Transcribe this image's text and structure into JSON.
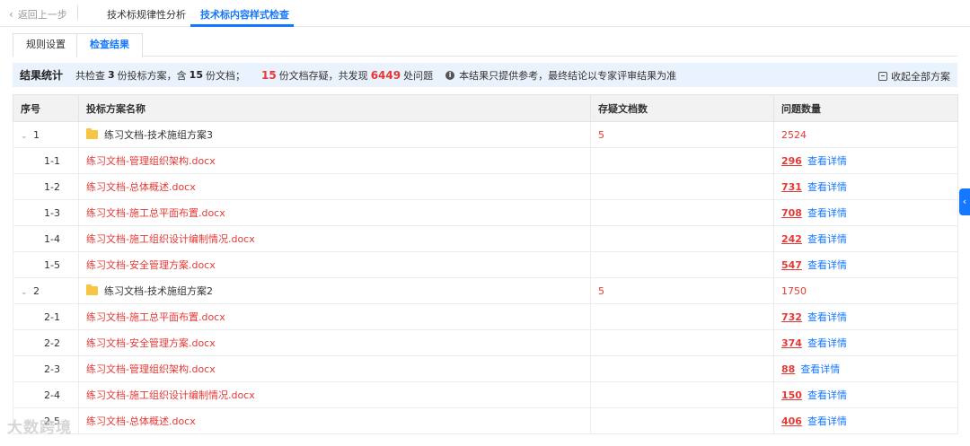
{
  "topnav": {
    "back_label": "返回上一步",
    "tabs": [
      {
        "label": "技术标规律性分析"
      },
      {
        "label": "技术标内容样式检查"
      }
    ]
  },
  "subtabs": [
    {
      "label": "规则设置"
    },
    {
      "label": "检查结果"
    }
  ],
  "stats": {
    "label": "结果统计",
    "t1": "共检查",
    "plans": "3",
    "t2": "份投标方案，含",
    "docs": "15",
    "t3": "份文档；",
    "suspicious": "15",
    "t4": "份文档存疑，共发现",
    "issues": "6449",
    "t5": "处问题",
    "note": "本结果只提供参考，最终结论以专家评审结果为准",
    "collapse_label": "收起全部方案"
  },
  "table": {
    "headers": [
      "序号",
      "投标方案名称",
      "存疑文档数",
      "问题数量"
    ],
    "detail_label": "查看详情",
    "groups": [
      {
        "idx": "1",
        "name": "练习文档-技术施组方案3",
        "doubt": "5",
        "issues": "2524",
        "rows": [
          {
            "idx": "1-1",
            "name": "练习文档-管理组织架构.docx",
            "count": "296"
          },
          {
            "idx": "1-2",
            "name": "练习文档-总体概述.docx",
            "count": "731"
          },
          {
            "idx": "1-3",
            "name": "练习文档-施工总平面布置.docx",
            "count": "708"
          },
          {
            "idx": "1-4",
            "name": "练习文档-施工组织设计编制情况.docx",
            "count": "242"
          },
          {
            "idx": "1-5",
            "name": "练习文档-安全管理方案.docx",
            "count": "547"
          }
        ]
      },
      {
        "idx": "2",
        "name": "练习文档-技术施组方案2",
        "doubt": "5",
        "issues": "1750",
        "rows": [
          {
            "idx": "2-1",
            "name": "练习文档-施工总平面布置.docx",
            "count": "732"
          },
          {
            "idx": "2-2",
            "name": "练习文档-安全管理方案.docx",
            "count": "374"
          },
          {
            "idx": "2-3",
            "name": "练习文档-管理组织架构.docx",
            "count": "88"
          },
          {
            "idx": "2-4",
            "name": "练习文档-施工组织设计编制情况.docx",
            "count": "150"
          },
          {
            "idx": "2-5",
            "name": "练习文档-总体概述.docx",
            "count": "406"
          }
        ]
      }
    ]
  },
  "side_handle_icon": "chevron-left-icon",
  "watermark": "大数跨境",
  "colors": {
    "accent": "#1677ff",
    "error": "#e53935",
    "stats_bg": "#eaf2fd",
    "folder": "#f6c544"
  }
}
